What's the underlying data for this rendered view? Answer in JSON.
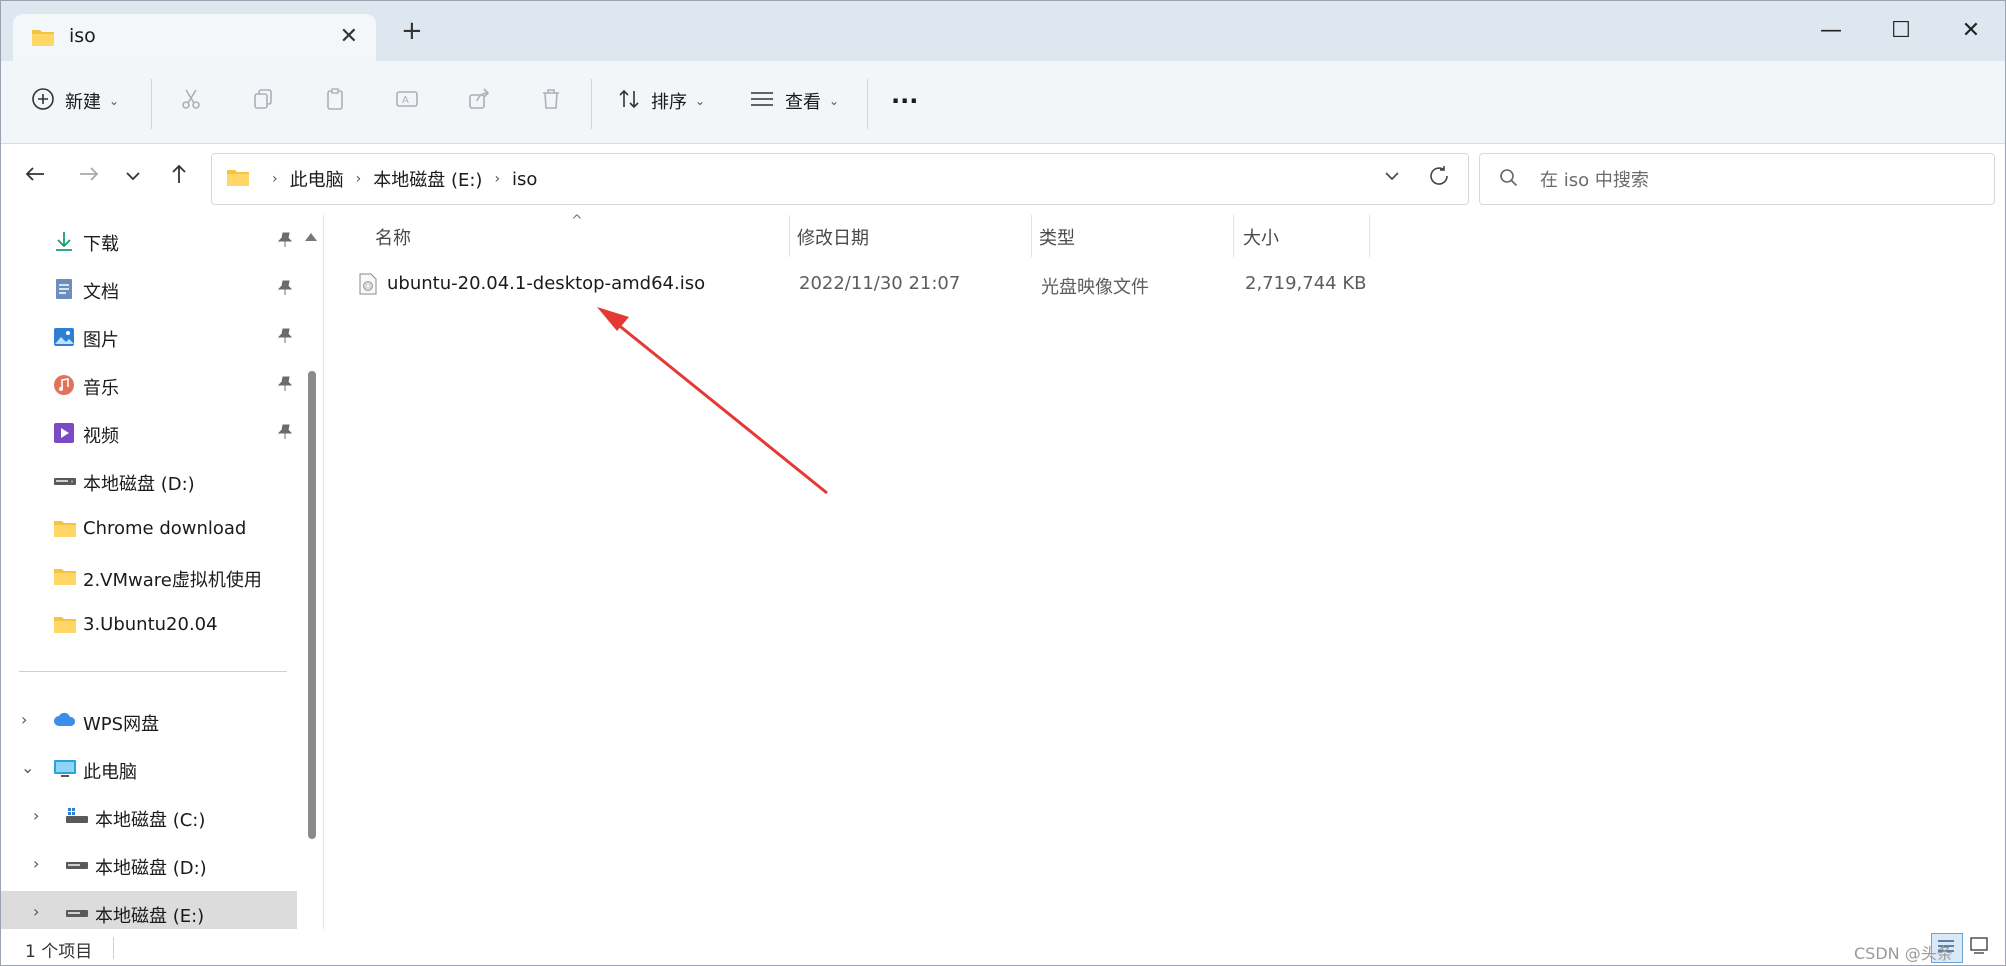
{
  "tab": {
    "title": "iso"
  },
  "toolbar": {
    "new_label": "新建",
    "sort_label": "排序",
    "view_label": "查看",
    "more_label": "···"
  },
  "breadcrumb": [
    "此电脑",
    "本地磁盘 (E:)",
    "iso"
  ],
  "search": {
    "placeholder": "在 iso 中搜索"
  },
  "sidebar": {
    "quick_access": [
      {
        "label": "下载",
        "icon": "download-icon",
        "pinned": true
      },
      {
        "label": "文档",
        "icon": "document-icon",
        "pinned": true
      },
      {
        "label": "图片",
        "icon": "pictures-icon",
        "pinned": true
      },
      {
        "label": "音乐",
        "icon": "music-icon",
        "pinned": true
      },
      {
        "label": "视频",
        "icon": "video-icon",
        "pinned": true
      },
      {
        "label": "本地磁盘 (D:)",
        "icon": "drive-icon",
        "pinned": false
      },
      {
        "label": "Chrome download",
        "icon": "folder-icon",
        "pinned": false
      },
      {
        "label": "2.VMware虚拟机使用",
        "icon": "folder-icon",
        "pinned": false
      },
      {
        "label": "3.Ubuntu20.04",
        "icon": "folder-icon",
        "pinned": false
      }
    ],
    "tree": [
      {
        "label": "WPS网盘",
        "icon": "cloud-icon",
        "expanded": false
      },
      {
        "label": "此电脑",
        "icon": "computer-icon",
        "expanded": true
      },
      {
        "label": "本地磁盘 (C:)",
        "icon": "drive-icon",
        "expanded": false
      },
      {
        "label": "本地磁盘 (D:)",
        "icon": "drive-icon",
        "expanded": false
      },
      {
        "label": "本地磁盘 (E:)",
        "icon": "drive-icon",
        "expanded": false,
        "selected": true
      }
    ]
  },
  "columns": {
    "name": "名称",
    "modified": "修改日期",
    "type": "类型",
    "size": "大小"
  },
  "files": [
    {
      "name": "ubuntu-20.04.1-desktop-amd64.iso",
      "modified": "2022/11/30 21:07",
      "type": "光盘映像文件",
      "size": "2,719,744 KB"
    }
  ],
  "status": {
    "count": "1 个项目"
  },
  "watermark": "CSDN @头条",
  "colors": {
    "titlebar": "#dee7ef",
    "folder": "#f5c242",
    "annotation_arrow": "#e53935",
    "selected_row": "#dcdcdc"
  }
}
